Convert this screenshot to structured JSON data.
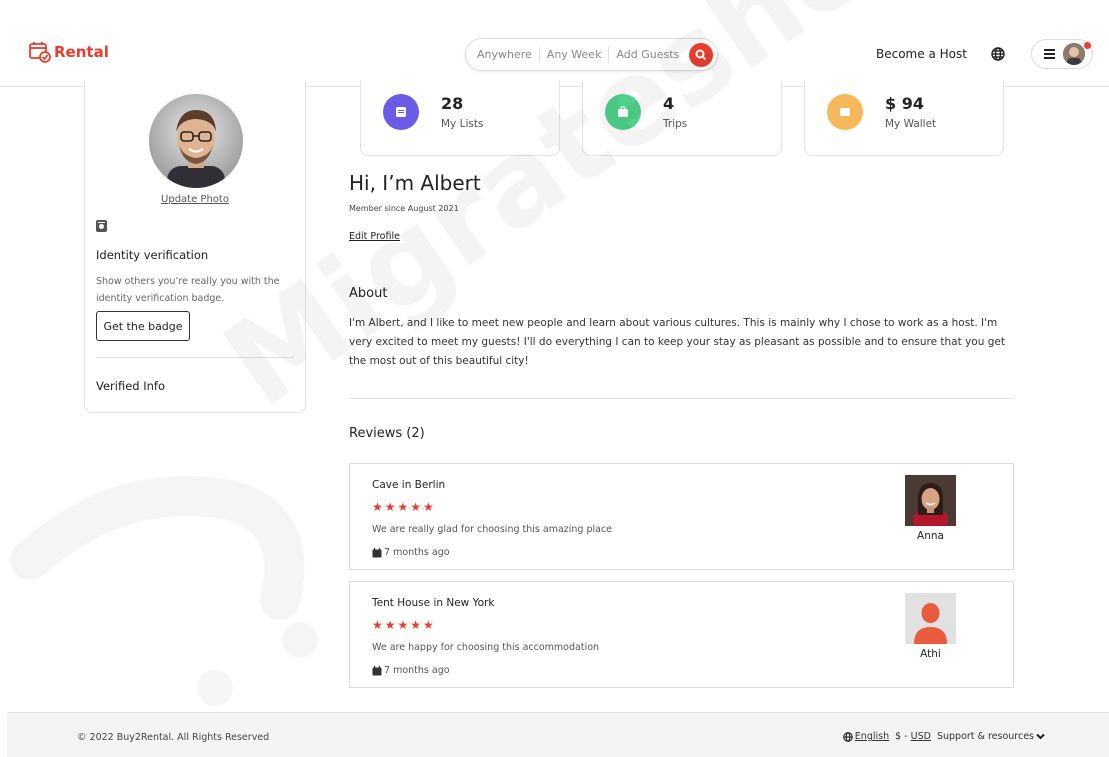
{
  "header": {
    "logo_text": "Rental",
    "search": {
      "location": "Anywhere",
      "week": "Any Week",
      "guests": "Add Guests"
    },
    "become_host": "Become a Host"
  },
  "sidebar": {
    "update_photo": "Update Photo",
    "identity_title": "Identity verification",
    "identity_desc": "Show others you’re really you with the identity verification badge.",
    "badge_button": "Get the badge",
    "verified_info": "Verified Info"
  },
  "stats": [
    {
      "value": "28",
      "label": "My Lists",
      "color": "#6b5ce7"
    },
    {
      "value": "4",
      "label": "Trips",
      "color": "#4fd08a"
    },
    {
      "value": "$ 94",
      "label": "My Wallet",
      "color": "#f6b85a"
    }
  ],
  "profile": {
    "greeting": "Hi, I’m Albert",
    "member_since": "Member since August 2021",
    "edit_profile": "Edit Profile",
    "about_title": "About",
    "about_text": "I'm Albert, and I like to meet new people and learn about various cultures. This is mainly why I chose to work as a host. I'm very excited to meet my guests! I'll do everything I can to keep your stay as pleasant as possible and to ensure that you get the most out of this beautiful city!"
  },
  "reviews": {
    "title": "Reviews (2)",
    "items": [
      {
        "place": "Cave in Berlin",
        "stars": "★★★★★",
        "text": "We are really glad for choosing this amazing place",
        "time": "7 months ago",
        "name": "Anna"
      },
      {
        "place": "Tent House in New York",
        "stars": "★★★★★",
        "text": "We are happy for choosing this accommodation",
        "time": "7 months ago",
        "name": "Athi"
      }
    ]
  },
  "footer": {
    "copyright": "© 2022 Buy2Rental. All Rights Reserved",
    "language": "English",
    "currency_symbol": "$ -",
    "currency": "USD",
    "support": "Support & resources"
  },
  "watermark": "Migrateshop",
  "colors": {
    "accent": "#ea3d2f"
  }
}
